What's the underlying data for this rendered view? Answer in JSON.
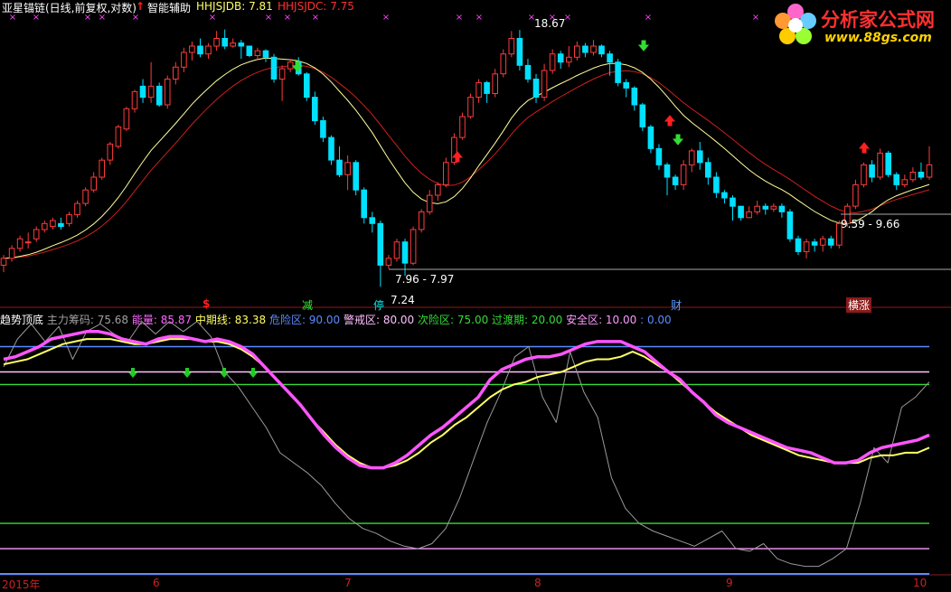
{
  "top_header": {
    "stock": "亚星锚链(日线,前复权,对数)",
    "indicator_arrow": "↑",
    "indicator_name": "智能辅助",
    "hhjsjdb_label": "HHJSJDB: 7.81",
    "hhjsjdc_label": "HHJSJDC: 7.75"
  },
  "logo": {
    "title": "分析家公式网",
    "url": "www.88gs.com"
  },
  "bottom_header": {
    "name": "趋势顶底",
    "items": [
      {
        "text": "主力筹码: 75.68",
        "color": "#a0a0a0"
      },
      {
        "text": "能量: 85.87",
        "color": "#ff66ff"
      },
      {
        "text": "中期线: 83.38",
        "color": "#ffff66"
      },
      {
        "text": "危险区: 90.00",
        "color": "#5a8cff"
      },
      {
        "text": "警戒区: 80.00",
        "color": "#ffc0ff"
      },
      {
        "text": "次险区: 75.00",
        "color": "#33dd33"
      },
      {
        "text": "过渡期: 20.00",
        "color": "#33dd33"
      },
      {
        "text": "安全区: 10.00",
        "color": "#ff99ff"
      },
      {
        "text": ": 0.00",
        "color": "#5a8cff"
      }
    ]
  },
  "annotations": {
    "high": "18.67",
    "range1": "7.96 - 7.97",
    "low": "7.24",
    "range2": "9.59 - 9.66"
  },
  "labels": {
    "s": "$",
    "jian": "减",
    "ting": "停",
    "cai": "财",
    "heng": "横涨"
  },
  "x_axis": [
    "2015年",
    "6",
    "7",
    "8",
    "9",
    "10"
  ],
  "chart_data": [
    {
      "type": "candlestick",
      "title": "亚星锚链(日线,前复权,对数)",
      "y_scale": "log",
      "marked_values": {
        "high": 18.67,
        "low": 7.24,
        "range1": [
          7.96,
          7.97
        ],
        "range2": [
          9.59,
          9.66
        ]
      },
      "series": [
        {
          "name": "HHJSJDB",
          "last": 7.81,
          "color": "#ffff99"
        },
        {
          "name": "HHJSJDC",
          "last": 7.75,
          "color": "#cc2020"
        }
      ],
      "candles_approx": "prices read from log axis",
      "candles": [
        [
          7.9,
          8.1,
          7.7,
          8.2
        ],
        [
          8.1,
          8.4,
          8.0,
          8.5
        ],
        [
          8.4,
          8.7,
          8.3,
          8.8
        ],
        [
          8.6,
          8.6,
          8.4,
          8.9
        ],
        [
          8.7,
          9.0,
          8.6,
          9.1
        ],
        [
          9.0,
          9.2,
          8.9,
          9.3
        ],
        [
          9.1,
          9.3,
          9.0,
          9.4
        ],
        [
          9.2,
          9.1,
          9.0,
          9.4
        ],
        [
          9.2,
          9.5,
          9.1,
          9.6
        ],
        [
          9.5,
          9.9,
          9.4,
          10.0
        ],
        [
          9.9,
          10.4,
          9.8,
          10.5
        ],
        [
          10.4,
          10.9,
          10.3,
          11.1
        ],
        [
          10.9,
          11.6,
          10.8,
          11.7
        ],
        [
          11.6,
          12.3,
          11.4,
          12.4
        ],
        [
          12.2,
          13.1,
          12.1,
          13.2
        ],
        [
          13.0,
          14.0,
          12.9,
          14.1
        ],
        [
          14.0,
          14.9,
          13.8,
          15.0
        ],
        [
          15.2,
          14.6,
          14.3,
          15.6
        ],
        [
          14.6,
          15.2,
          14.3,
          16.6
        ],
        [
          15.2,
          14.2,
          14.1,
          15.4
        ],
        [
          14.2,
          15.6,
          14.0,
          15.8
        ],
        [
          15.6,
          16.3,
          15.3,
          16.6
        ],
        [
          16.3,
          17.2,
          16.0,
          17.5
        ],
        [
          17.2,
          17.6,
          16.7,
          17.9
        ],
        [
          17.6,
          17.1,
          16.9,
          18.1
        ],
        [
          17.1,
          17.6,
          16.8,
          17.8
        ],
        [
          17.6,
          18.1,
          17.3,
          18.6
        ],
        [
          18.1,
          17.6,
          17.4,
          18.7
        ],
        [
          17.6,
          17.8,
          17.5,
          18.1
        ],
        [
          17.8,
          17.6,
          16.8,
          18.0
        ],
        [
          17.6,
          17.0,
          16.9,
          17.6
        ],
        [
          17.0,
          17.3,
          16.7,
          17.5
        ],
        [
          17.3,
          16.9,
          16.6,
          17.4
        ],
        [
          16.9,
          15.6,
          15.4,
          17.1
        ],
        [
          15.6,
          16.2,
          14.4,
          16.4
        ],
        [
          16.2,
          16.6,
          16.0,
          16.8
        ],
        [
          16.6,
          15.9,
          15.8,
          16.9
        ],
        [
          15.9,
          14.6,
          14.4,
          16.0
        ],
        [
          14.6,
          13.4,
          13.2,
          14.9
        ],
        [
          13.4,
          12.6,
          12.4,
          13.6
        ],
        [
          12.6,
          11.6,
          11.4,
          12.7
        ],
        [
          11.6,
          11.0,
          10.9,
          12.2
        ],
        [
          11.0,
          11.5,
          10.4,
          11.8
        ],
        [
          11.5,
          10.4,
          10.2,
          11.6
        ],
        [
          10.4,
          9.4,
          9.2,
          10.5
        ],
        [
          9.4,
          9.2,
          8.9,
          9.6
        ],
        [
          9.2,
          7.9,
          7.3,
          9.3
        ],
        [
          7.9,
          8.1,
          7.8,
          8.2
        ],
        [
          8.1,
          8.6,
          8.0,
          8.7
        ],
        [
          8.6,
          7.96,
          7.6,
          8.7
        ],
        [
          7.96,
          9.0,
          7.9,
          9.1
        ],
        [
          9.0,
          9.6,
          8.9,
          9.7
        ],
        [
          9.6,
          10.2,
          9.5,
          10.4
        ],
        [
          10.2,
          10.6,
          10.0,
          10.7
        ],
        [
          10.6,
          11.5,
          10.5,
          11.7
        ],
        [
          11.5,
          12.6,
          11.4,
          12.8
        ],
        [
          12.6,
          13.6,
          12.5,
          13.8
        ],
        [
          13.6,
          14.6,
          13.5,
          14.8
        ],
        [
          14.6,
          15.4,
          14.3,
          15.6
        ],
        [
          15.4,
          14.8,
          14.3,
          15.5
        ],
        [
          14.8,
          15.9,
          14.6,
          16.2
        ],
        [
          15.9,
          17.1,
          15.7,
          17.4
        ],
        [
          17.1,
          18.1,
          16.9,
          18.6
        ],
        [
          18.1,
          16.4,
          16.1,
          18.67
        ],
        [
          16.4,
          15.6,
          15.4,
          16.8
        ],
        [
          15.6,
          14.6,
          14.3,
          15.9
        ],
        [
          14.6,
          16.1,
          14.4,
          16.5
        ],
        [
          16.1,
          17.1,
          15.9,
          17.4
        ],
        [
          17.1,
          16.6,
          16.2,
          17.3
        ],
        [
          16.6,
          16.9,
          16.3,
          17.6
        ],
        [
          16.9,
          17.6,
          16.7,
          17.9
        ],
        [
          17.6,
          17.2,
          16.9,
          17.8
        ],
        [
          17.2,
          17.6,
          17.0,
          18.0
        ],
        [
          17.6,
          17.1,
          16.9,
          17.7
        ],
        [
          17.1,
          16.6,
          15.8,
          17.3
        ],
        [
          16.6,
          15.4,
          15.2,
          16.8
        ],
        [
          15.4,
          15.1,
          14.6,
          15.6
        ],
        [
          15.1,
          14.2,
          13.9,
          15.2
        ],
        [
          14.2,
          13.1,
          12.9,
          14.3
        ],
        [
          13.1,
          12.1,
          11.9,
          13.2
        ],
        [
          12.1,
          11.4,
          11.2,
          12.3
        ],
        [
          11.4,
          10.9,
          10.2,
          11.5
        ],
        [
          10.9,
          10.6,
          10.4,
          11.0
        ],
        [
          10.6,
          11.4,
          10.4,
          11.6
        ],
        [
          11.4,
          12.0,
          11.1,
          12.1
        ],
        [
          12.0,
          11.5,
          11.2,
          12.4
        ],
        [
          11.5,
          10.9,
          10.6,
          11.7
        ],
        [
          10.9,
          10.3,
          10.1,
          11.1
        ],
        [
          10.3,
          10.1,
          9.9,
          10.4
        ],
        [
          10.1,
          9.8,
          9.3,
          10.2
        ],
        [
          9.8,
          9.4,
          9.3,
          9.7
        ],
        [
          9.4,
          9.6,
          9.4,
          9.8
        ],
        [
          9.6,
          9.8,
          9.5,
          10.0
        ],
        [
          9.8,
          9.7,
          9.5,
          9.9
        ],
        [
          9.7,
          9.8,
          9.6,
          9.9
        ],
        [
          9.8,
          9.6,
          9.4,
          9.9
        ],
        [
          9.6,
          8.7,
          8.6,
          9.7
        ],
        [
          8.7,
          8.3,
          8.2,
          8.8
        ],
        [
          8.3,
          8.6,
          8.1,
          8.7
        ],
        [
          8.6,
          8.5,
          8.3,
          8.7
        ],
        [
          8.5,
          8.7,
          8.3,
          8.8
        ],
        [
          8.7,
          8.5,
          8.4,
          8.8
        ],
        [
          8.5,
          9.2,
          8.4,
          9.3
        ],
        [
          9.2,
          9.8,
          9.1,
          9.9
        ],
        [
          9.8,
          10.6,
          9.7,
          10.8
        ],
        [
          10.6,
          11.4,
          10.5,
          11.5
        ],
        [
          11.4,
          10.9,
          10.7,
          11.6
        ],
        [
          10.9,
          11.9,
          10.8,
          12.1
        ],
        [
          11.9,
          11.0,
          10.9,
          12.0
        ],
        [
          11.0,
          10.6,
          10.4,
          11.1
        ],
        [
          10.6,
          10.8,
          10.5,
          11.0
        ],
        [
          10.8,
          11.1,
          10.7,
          11.3
        ],
        [
          11.1,
          10.9,
          10.8,
          11.5
        ],
        [
          10.9,
          11.4,
          10.8,
          12.2
        ]
      ]
    },
    {
      "type": "line",
      "title": "趋势顶底",
      "y_range": [
        0,
        100
      ],
      "reference_lines": [
        {
          "name": "危险区",
          "value": 90,
          "color": "#5a8cff"
        },
        {
          "name": "警戒区",
          "value": 80,
          "color": "#ffc0ff"
        },
        {
          "name": "次险区",
          "value": 75,
          "color": "#33dd33"
        },
        {
          "name": "过渡期",
          "value": 20,
          "color": "#33dd33"
        },
        {
          "name": "安全区",
          "value": 10,
          "color": "#ff99ff"
        },
        {
          "name": "",
          "value": 0,
          "color": "#5a8cff"
        }
      ],
      "series": [
        {
          "name": "能量",
          "last": 85.87,
          "color": "#ff66ff"
        },
        {
          "name": "中期线",
          "last": 83.38,
          "color": "#ffff66"
        },
        {
          "name": "主力筹码",
          "last": 75.68,
          "color": "#a0a0a0"
        }
      ],
      "energy": [
        85,
        86,
        88,
        90,
        93,
        94,
        95,
        96,
        96,
        95,
        93,
        92,
        91,
        93,
        94,
        94,
        93,
        92,
        93,
        92,
        90,
        87,
        82,
        77,
        72,
        67,
        61,
        55,
        50,
        46,
        43,
        42,
        42,
        44,
        47,
        51,
        55,
        58,
        62,
        66,
        70,
        77,
        81,
        83,
        85,
        86,
        86,
        87,
        89,
        91,
        92,
        92,
        92,
        90,
        88,
        84,
        80,
        77,
        72,
        68,
        63,
        60,
        58,
        56,
        54,
        52,
        50,
        49,
        48,
        46,
        44,
        44,
        45,
        48,
        50,
        51,
        52,
        53,
        55
      ],
      "midline": [
        83,
        84,
        85,
        87,
        89,
        91,
        92,
        93,
        93,
        93,
        92,
        91,
        91,
        92,
        93,
        93,
        93,
        92,
        92,
        91,
        89,
        86,
        82,
        77,
        72,
        67,
        61,
        56,
        51,
        47,
        44,
        42,
        42,
        43,
        45,
        48,
        52,
        55,
        59,
        62,
        66,
        70,
        73,
        75,
        76,
        78,
        79,
        80,
        82,
        84,
        85,
        85,
        86,
        88,
        86,
        83,
        80,
        76,
        72,
        68,
        64,
        61,
        58,
        55,
        53,
        51,
        49,
        47,
        46,
        45,
        44,
        44,
        44,
        46,
        47,
        47,
        48,
        48,
        50
      ],
      "chips": [
        82,
        93,
        99,
        92,
        98,
        85,
        96,
        99,
        95,
        92,
        100,
        95,
        100,
        96,
        100,
        94,
        80,
        74,
        66,
        58,
        48,
        44,
        40,
        35,
        28,
        22,
        18,
        16,
        13,
        11,
        10,
        12,
        18,
        30,
        45,
        60,
        72,
        86,
        90,
        70,
        60,
        88,
        72,
        62,
        38,
        26,
        20,
        17,
        15,
        13,
        11,
        14,
        17,
        10,
        9,
        12,
        6,
        4,
        3,
        3,
        6,
        10,
        28,
        50,
        44,
        66,
        70,
        76
      ]
    }
  ]
}
